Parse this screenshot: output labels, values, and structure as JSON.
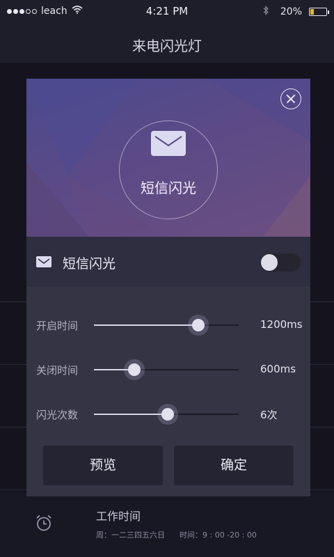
{
  "status_bar": {
    "carrier": "leach",
    "time": "4:21 PM",
    "battery": "20%",
    "battery_level": 0.2
  },
  "header": {
    "title": "来电闪光灯"
  },
  "background": {
    "work_time": {
      "title": "工作时间",
      "days": "周：一二三四五六日",
      "time": "时间：9 : 00 -20 : 00"
    }
  },
  "dialog": {
    "hero_label": "短信闪光",
    "toggle": {
      "label": "短信闪光",
      "on": false
    },
    "sliders": [
      {
        "label": "开启时间",
        "value": "1200ms",
        "fraction": 0.72
      },
      {
        "label": "关闭时间",
        "value": "600ms",
        "fraction": 0.28
      },
      {
        "label": "闪光次数",
        "value": "6次",
        "fraction": 0.51
      }
    ],
    "buttons": {
      "preview": "预览",
      "confirm": "确定"
    }
  },
  "icons": {
    "hero": "envelope-icon",
    "row": "envelope-icon",
    "close": "close-icon",
    "alarm": "alarm-clock-icon",
    "wifi": "wifi-icon",
    "bluetooth": "bluetooth-icon",
    "battery": "battery-icon"
  },
  "colors": {
    "accent": "#dcdaf0",
    "battery_fill": "#e8b830",
    "dialog_bg": "#2d2c3c"
  }
}
